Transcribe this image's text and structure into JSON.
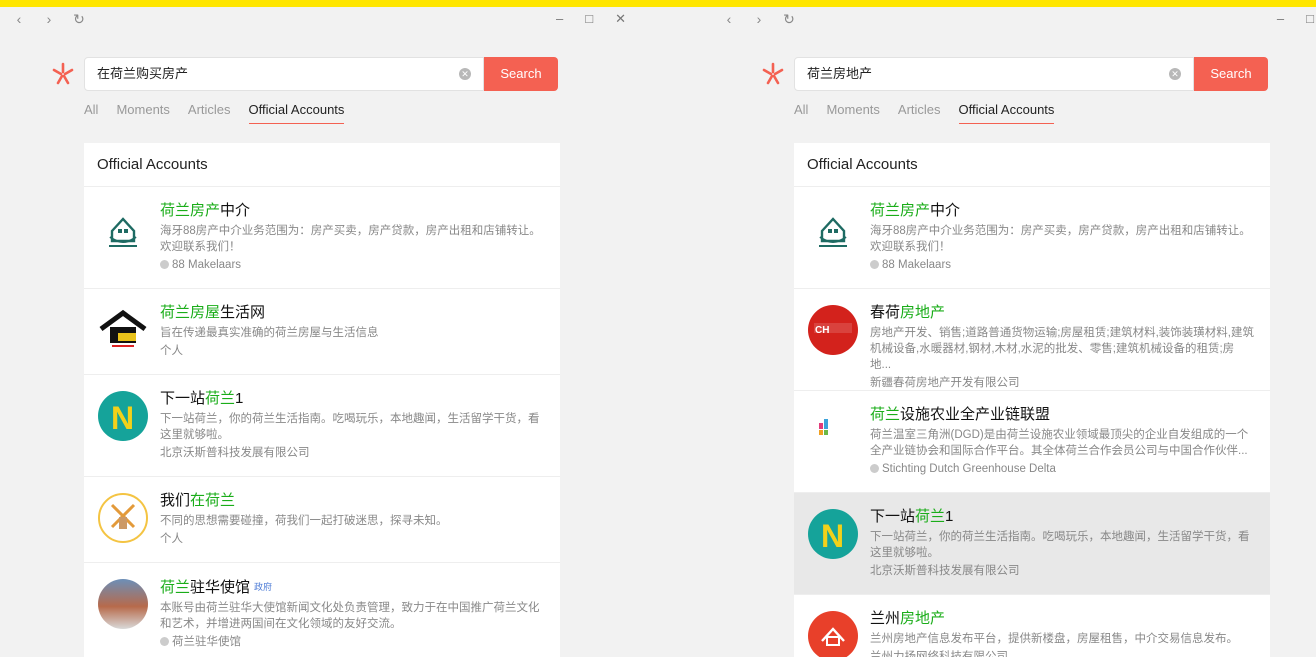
{
  "left": {
    "search_value": "在荷兰购买房产",
    "search_button": "Search",
    "tabs": [
      "All",
      "Moments",
      "Articles",
      "Official Accounts"
    ],
    "panel_title": "Official Accounts",
    "items": [
      {
        "name_hit": "荷兰房产",
        "name_rest": "中介",
        "desc": "海牙88房产中介业务范围为：房产买卖，房产贷款，房产出租和店铺转让。欢迎联系我们！",
        "org": "88 Makelaars"
      },
      {
        "name_hit": "荷兰房屋",
        "name_rest": "生活网",
        "desc": "旨在传递最真实准确的荷兰房屋与生活信息",
        "org": "个人"
      },
      {
        "name_pre": "下一站",
        "name_hit": "荷兰",
        "name_rest": "1",
        "desc": "下一站荷兰，你的荷兰生活指南。吃喝玩乐，本地趣闻，生活留学干货，看这里就够啦。",
        "org": "北京沃斯普科技发展有限公司"
      },
      {
        "name_pre": "我们",
        "name_hit": "在荷兰",
        "name_rest": "",
        "desc": "不同的思想需要碰撞，荷我们一起打破迷思，探寻未知。",
        "org": "个人"
      },
      {
        "name_hit": "荷兰",
        "name_rest": "驻华使馆",
        "badge": "政府",
        "desc": "本账号由荷兰驻华大使馆新闻文化处负责管理，致力于在中国推广荷兰文化和艺术，并增进两国间在文化领域的友好交流。",
        "org": "荷兰驻华使馆"
      }
    ]
  },
  "right": {
    "search_value": "荷兰房地产",
    "search_button": "Search",
    "tabs": [
      "All",
      "Moments",
      "Articles",
      "Official Accounts"
    ],
    "panel_title": "Official Accounts",
    "items": [
      {
        "name_hit": "荷兰房产",
        "name_rest": "中介",
        "desc": "海牙88房产中介业务范围为：房产买卖，房产贷款，房产出租和店铺转让。欢迎联系我们！",
        "org": "88 Makelaars"
      },
      {
        "name_pre": "春荷",
        "name_hit": "房地产",
        "name_rest": "",
        "desc": "房地产开发、销售;道路普通货物运输;房屋租赁;建筑材料,装饰装璜材料,建筑机械设备,水暖器材,钢材,木材,水泥的批发、零售;建筑机械设备的租赁;房地...",
        "org": "新疆春荷房地产开发有限公司"
      },
      {
        "name_hit": "荷兰",
        "name_rest": "设施农业全产业链联盟",
        "desc": "荷兰温室三角洲(DGD)是由荷兰设施农业领域最顶尖的企业自发组成的一个全产业链协会和国际合作平台。其全体荷兰合作会员公司与中国合作伙伴...",
        "org": "Stichting Dutch Greenhouse Delta"
      },
      {
        "name_pre": "下一站",
        "name_hit": "荷兰",
        "name_rest": "1",
        "desc": "下一站荷兰，你的荷兰生活指南。吃喝玩乐，本地趣闻，生活留学干货，看这里就够啦。",
        "org": "北京沃斯普科技发展有限公司"
      },
      {
        "name_pre": "兰州",
        "name_hit": "房地产",
        "name_rest": "",
        "desc": "兰州房地产信息发布平台，提供新楼盘，房屋租售，中介交易信息发布。",
        "org": "兰州力扬网络科技有限公司"
      }
    ]
  }
}
